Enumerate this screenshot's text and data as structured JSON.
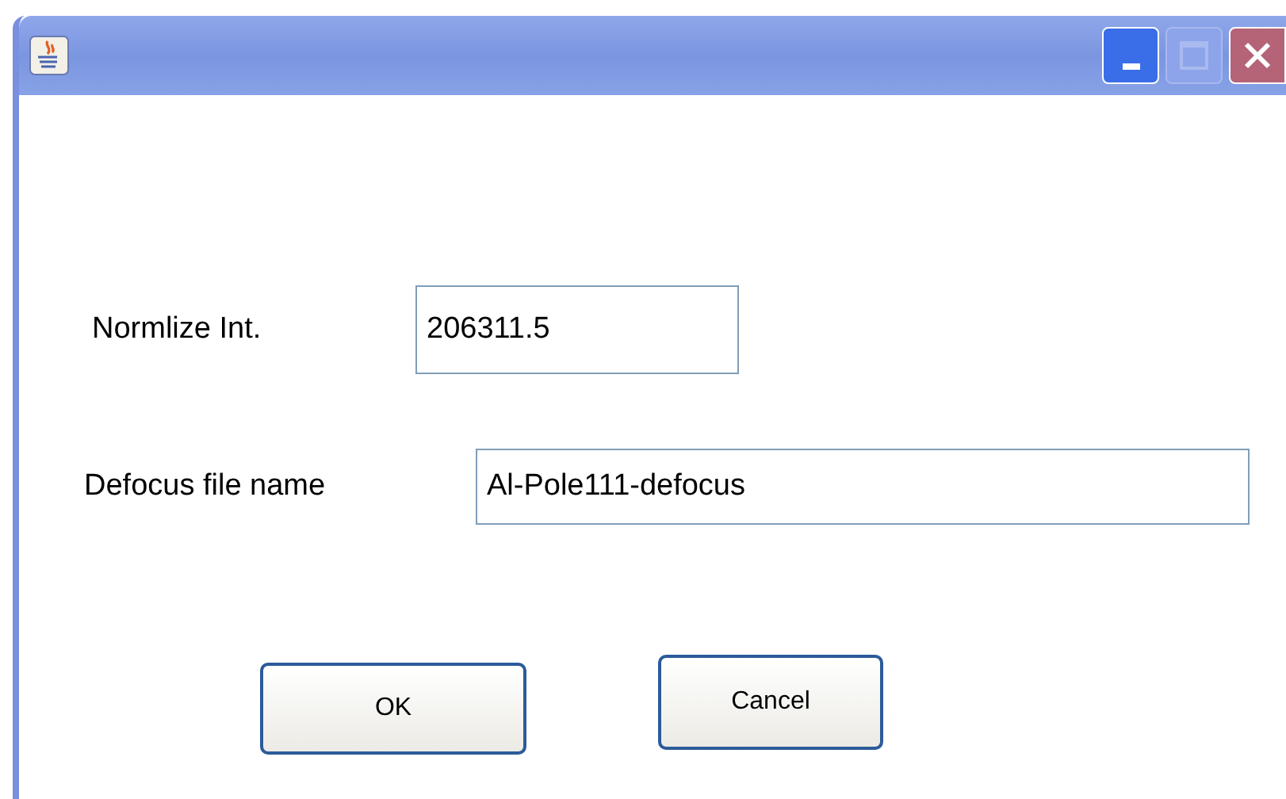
{
  "window": {
    "maximize_disabled": true
  },
  "fields": [
    {
      "label": "Normlize Int.",
      "value": "206311.5"
    },
    {
      "label": "Defocus file name",
      "value": "Al-Pole111-defocus"
    }
  ],
  "buttons": [
    "OK",
    "Cancel"
  ]
}
